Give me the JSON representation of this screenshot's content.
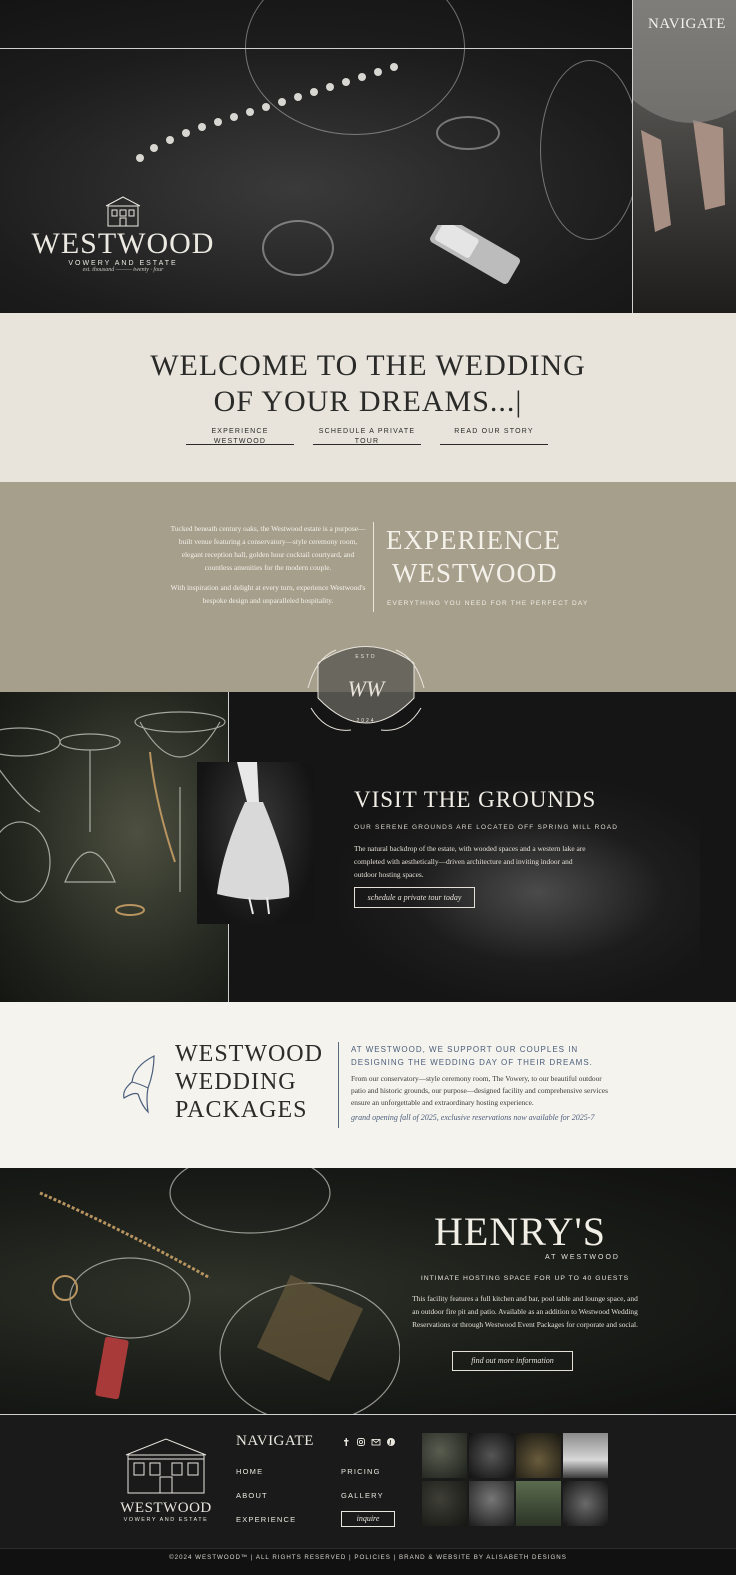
{
  "hero": {
    "nav_label": "NAVIGATE",
    "logo_word": "WESTWOOD",
    "logo_sub": "VOWERY AND ESTATE",
    "logo_est": "est. thousand ——— twenty · four"
  },
  "welcome": {
    "heading_line1": "WELCOME TO THE WEDDING",
    "heading_line2": "OF YOUR DREAMS...|",
    "links": [
      "EXPERIENCE WESTWOOD",
      "SCHEDULE A PRIVATE TOUR",
      "READ OUR STORY"
    ]
  },
  "experience": {
    "para1": "Tucked beneath century oaks, the Westwood estate is a purpose—built venue featuring a conservatory—style ceremony room, elegant reception hall, golden hour cocktail courtyard, and countless amenities for the modern couple.",
    "para2": "With inspiration and delight at every turn, experience Westwood's bespoke design and unparalleled hospitality.",
    "title_line1": "EXPERIENCE",
    "title_line2": "WESTWOOD",
    "subtitle": "EVERYTHING YOU NEED FOR THE PERFECT DAY"
  },
  "crest": {
    "top": "ESTD",
    "monogram": "WW",
    "year": "2024"
  },
  "grounds": {
    "title": "VISIT THE GROUNDS",
    "subtitle": "OUR SERENE GROUNDS ARE LOCATED OFF SPRING MILL ROAD",
    "body": "The natural backdrop of the estate, with wooded spaces and a western lake are completed with aesthetically—driven architecture and inviting indoor and outdoor hosting spaces.",
    "button": "schedule a private tour today"
  },
  "packages": {
    "title_line1": "WESTWOOD",
    "title_line2": "WEDDING",
    "title_line3": "PACKAGES",
    "lead": "AT WESTWOOD, WE SUPPORT OUR COUPLES IN DESIGNING THE WEDDING DAY OF THEIR DREAMS.",
    "body": "From our conservatory—style ceremony room, The Vowery, to our beautiful outdoor patio and historic grounds, our purpose—designed facility and comprehensive services ensure an unforgettable and extraordinary hosting experience.",
    "note": "grand opening fall of 2025, exclusive reservations now available for 2025-7"
  },
  "henrys": {
    "title": "HENRY'S",
    "at": "AT WESTWOOD",
    "subtitle": "INTIMATE HOSTING SPACE FOR UP TO 40 GUESTS",
    "body": "This facility features a full kitchen and bar, pool table and lounge space, and an outdoor fire pit and patio. Available as an addition to Westwood Wedding Reservations or through Westwood Event Packages for corporate and social.",
    "button": "find out more information"
  },
  "footer": {
    "logo_word": "WESTWOOD",
    "logo_sub": "VOWERY AND ESTATE",
    "nav_title": "NAVIGATE",
    "links_col1": [
      "HOME",
      "ABOUT",
      "EXPERIENCE"
    ],
    "links_col2": [
      "PRICING",
      "GALLERY"
    ],
    "inquire": "inquire",
    "social_icons": [
      "facebook-icon",
      "instagram-icon",
      "email-icon",
      "pinterest-icon"
    ],
    "copyright": "©2024 WESTWOOD™ | ALL RIGHTS RESERVED | POLICIES | BRAND & WEBSITE BY ALISABETH DESIGNS"
  },
  "colors": {
    "cream": "#e8e4dc",
    "taupe": "#a69f8c",
    "dark": "#151515",
    "ivory": "#f5f3ed",
    "slate_blue": "#4a5e7c"
  }
}
